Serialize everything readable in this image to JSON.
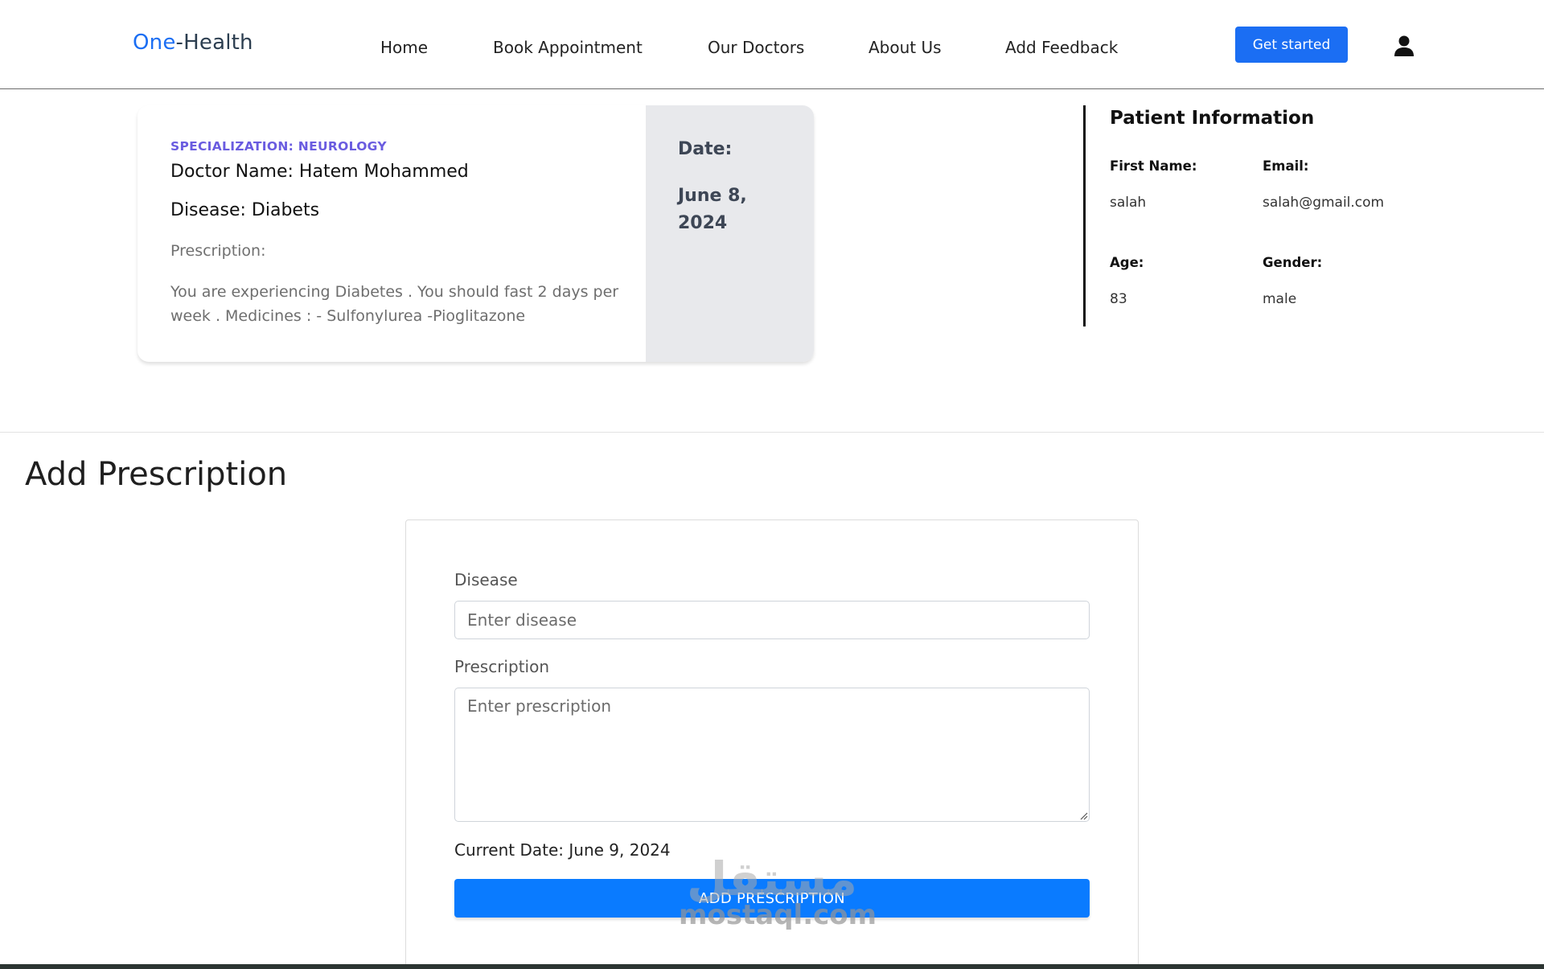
{
  "navbar": {
    "brand_part1": "One",
    "brand_part2": "-Health",
    "links": [
      "Home",
      "Book Appointment",
      "Our Doctors",
      "About Us",
      "Add Feedback"
    ],
    "cta_label": "Get started",
    "user_icon": "user-icon"
  },
  "appointment": {
    "specialization": "SPECIALIZATION: NEUROLOGY",
    "doctor_name": "Doctor Name: Hatem Mohammed",
    "disease": "Disease: Diabets",
    "prescription_label": "Prescription:",
    "prescription_text": "You are experiencing Diabetes . You should fast 2 days per week . Medicines : - Sulfonylurea -Pioglitazone",
    "date_label": "Date:",
    "date_value": "June 8, 2024"
  },
  "patient": {
    "title": "Patient Information",
    "first_name_label": "First Name:",
    "first_name": "salah",
    "email_label": "Email:",
    "email": "salah@gmail.com",
    "age_label": "Age:",
    "age": "83",
    "gender_label": "Gender:",
    "gender": "male"
  },
  "form": {
    "section_title": "Add Prescription",
    "disease_label": "Disease",
    "disease_placeholder": "Enter disease",
    "prescription_label": "Prescription",
    "prescription_placeholder": "Enter prescription",
    "current_date": "Current Date: June 9, 2024",
    "submit_label": "ADD PRESCRIPTION"
  },
  "watermark": {
    "arabic": "مستقل",
    "url": "mostaql.com"
  },
  "colors": {
    "brand_blue": "#1b6ef3",
    "submit_blue": "#0a7bff",
    "specialization_purple": "#6a5ce0",
    "date_panel_bg": "#e8e9ec"
  }
}
